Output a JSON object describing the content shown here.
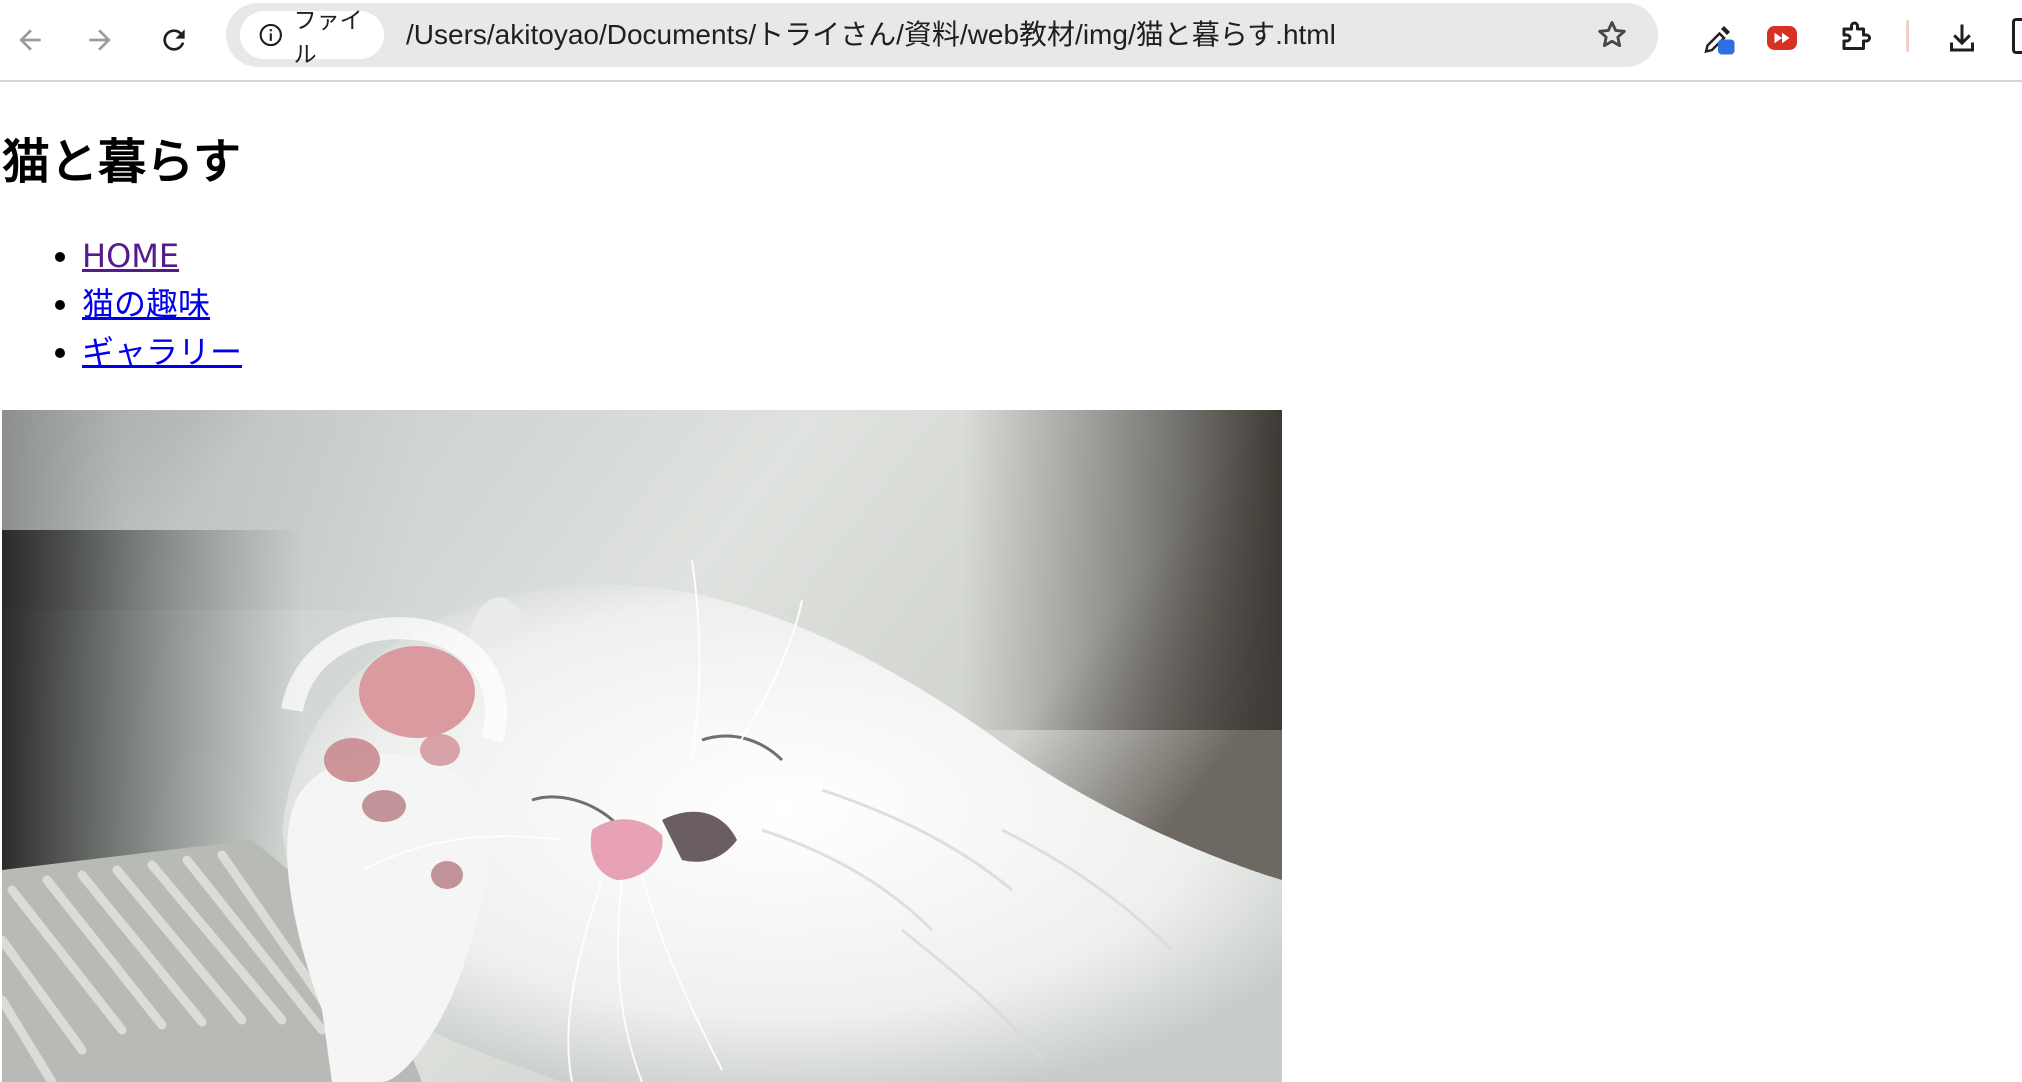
{
  "browser": {
    "back_label": "Back",
    "forward_label": "Forward",
    "reload_label": "Reload",
    "security_chip_label": "ファイル",
    "url": "/Users/akitoyao/Documents/トライさん/資料/web教材/img/猫と暮らす.html",
    "icons": [
      "arrow-left-icon",
      "arrow-right-icon",
      "reload-icon",
      "info-icon",
      "star-icon",
      "eyedropper-extension-icon",
      "video-extension-icon",
      "puzzle-icon",
      "download-icon"
    ],
    "colors": {
      "toolbar_bg": "#ffffff",
      "omnibox_bg": "#e8e8e8",
      "extension_red": "#d93025",
      "extension_blue": "#2f6fe0"
    }
  },
  "page": {
    "title": "猫と暮らす",
    "nav": [
      {
        "label": "HOME",
        "state": "visited"
      },
      {
        "label": "猫の趣味",
        "state": "link"
      },
      {
        "label": "ギャラリー",
        "state": "link"
      }
    ],
    "colors": {
      "visited_link": "#551a8b",
      "link": "#0000ee"
    },
    "hero_image": "sleeping-white-cat-photo"
  }
}
